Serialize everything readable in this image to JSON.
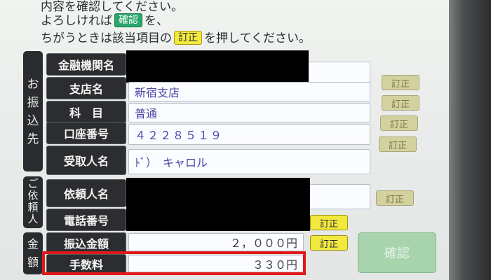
{
  "instructions": {
    "line1": "内容を確認してください。",
    "line2_pre": "よろしければ",
    "line2_chip": "確認",
    "line2_post": "を、",
    "line3_pre": "ちがうときは該当項目の",
    "line3_chip": "訂正",
    "line3_post": "を押してください。"
  },
  "sections": {
    "recipient": "お振込先",
    "requester": "ご依頼人",
    "amount": "金額"
  },
  "rows": {
    "bank": {
      "label": "金融機関名",
      "value": ""
    },
    "branch": {
      "label": "支店名",
      "value": "新宿支店",
      "button": "訂正"
    },
    "account_type": {
      "label": "科　目",
      "value": "普通",
      "button": "訂正"
    },
    "account_number": {
      "label": "口座番号",
      "value": "４２２８５１９",
      "button": "訂正"
    },
    "payee": {
      "label": "受取人名",
      "value": "ﾄﾞ）　キャロル",
      "button": "訂正"
    },
    "requester_name": {
      "label": "依頼人名",
      "value": "",
      "button": "訂正"
    },
    "phone": {
      "label": "電話番号",
      "value": "",
      "button": "訂正"
    },
    "transfer_amount": {
      "label": "振込金額",
      "value": "２，０００円",
      "button": "訂正"
    },
    "fee": {
      "label": "手数料",
      "value": "３３０円"
    }
  },
  "confirm_button": "確認",
  "colors": {
    "highlight": "#e0191a",
    "button_yellow": "#f2e93f",
    "field_text": "#4a46a8"
  }
}
